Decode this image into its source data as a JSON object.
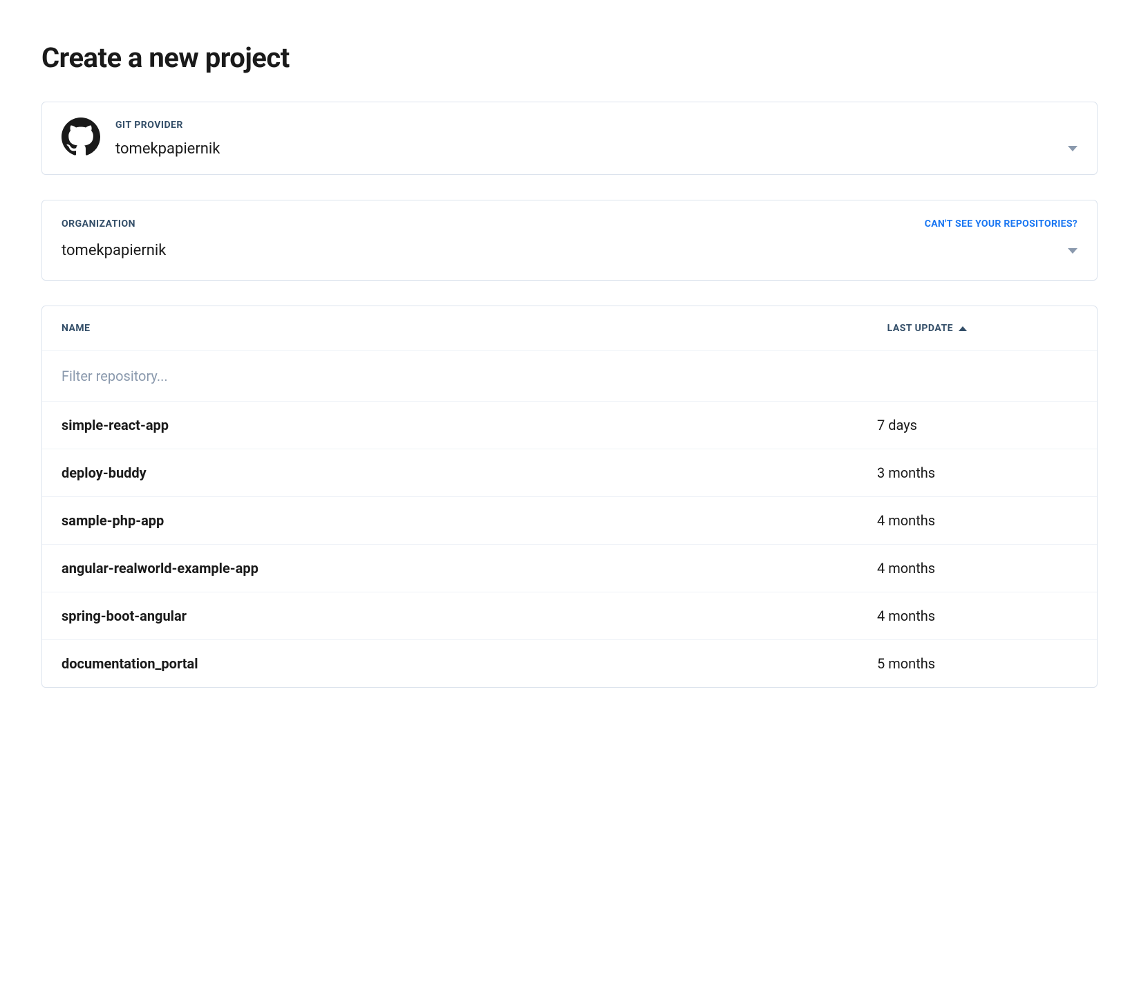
{
  "page_title": "Create a new project",
  "provider": {
    "label": "GIT PROVIDER",
    "value": "tomekpapiernik"
  },
  "organization": {
    "label": "ORGANIZATION",
    "value": "tomekpapiernik",
    "help_link": "CAN'T SEE YOUR REPOSITORIES?"
  },
  "repo_table": {
    "columns": {
      "name": "NAME",
      "last_update": "LAST UPDATE"
    },
    "filter_placeholder": "Filter repository...",
    "rows": [
      {
        "name": "simple-react-app",
        "last_update": "7 days"
      },
      {
        "name": "deploy-buddy",
        "last_update": "3 months"
      },
      {
        "name": "sample-php-app",
        "last_update": "4 months"
      },
      {
        "name": "angular-realworld-example-app",
        "last_update": "4 months"
      },
      {
        "name": "spring-boot-angular",
        "last_update": "4 months"
      },
      {
        "name": "documentation_portal",
        "last_update": "5 months"
      }
    ]
  }
}
